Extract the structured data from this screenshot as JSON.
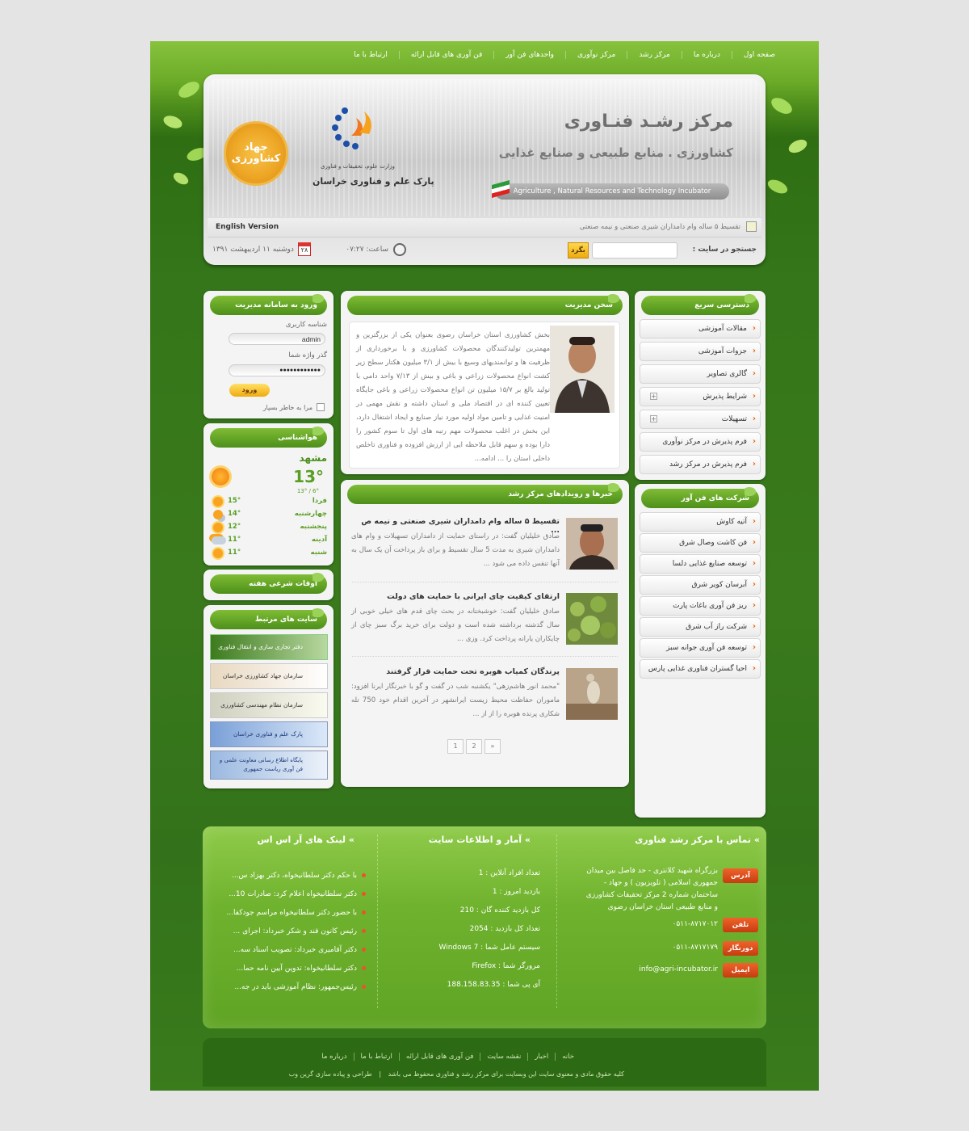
{
  "nav": {
    "items": [
      "صفحه اول",
      "درباره ما",
      "مرکز رشد",
      "مرکز نوآوری",
      "واحدهای فن آور",
      "فن آوری های قابل ارائه",
      "ارتباط با ما"
    ]
  },
  "header": {
    "title_line1": "مرکز رشـد فنـاوری",
    "title_line2": "کشاورزی . منابع طبیعی و صنایع غذایی",
    "english_banner": "Agriculture , Natural Resources and Technology Incubator",
    "park_name": "پارک علم و فناوری خراسان",
    "park_ministry": "وزارت علوم، تحقیقات و فناوری",
    "jahad_logo_text": "جهاد کشاورزی",
    "ticker": "تقسیط ۵ ساله وام دامداران شیری صنعتی و نیمه صنعتی",
    "english_version": "English Version",
    "search_label": "جستجو در سایت :",
    "search_button": "بگرد",
    "search_placeholder": "",
    "time_label": "ساعت: ۰۷:۲۷",
    "date_text": "دوشنبه ۱۱ اردیبهشت ۱۳۹۱",
    "calendar_day": "۲۸"
  },
  "quick_access": {
    "title": "دسترسی سریع",
    "items": [
      "مقالات آموزشی",
      "جزوات آموزشی",
      "گالری تصاویر",
      "شرایط پذیرش",
      "تسهیلات",
      "فرم پذیرش در مرکز نوآوری",
      "فرم پذیرش در مرکز رشد"
    ]
  },
  "companies": {
    "title": "شرکت های فن آور",
    "items": [
      "آتیه کاوش",
      "فن کاشت وصال شرق",
      "توسعه صنایع غذایی دلسا",
      "آبرسان کویر شرق",
      "ریز فن آوری باغات پارت",
      "شرکت راز آب شرق",
      "توسعه فن آوری جوانه سبز",
      "احیا گستران فناوری غذایی پارس"
    ]
  },
  "manager": {
    "title": "سخن مدیریت",
    "text": "بخش کشاورزی استان خراسان رضوی بعنوان یکی از بزرگترین و مهمترین تولیدکنندگان محصولات کشاورزی و با برخورداری از ظرفیت ها و توانمندیهای وسیع با بیش از ۳/۱ میلیون هکتار سطح زیر کشت انواع محصولات زراعی و باغی و بیش از ۷/۱۳ واحد دامی با تولید بالغ بر ۱۵/۷ میلیون تن انواع محصولات زراعی و باغی جایگاه تعیین کننده ای در اقتصاد ملی و استان داشته و نقش مهمی در امنیت غذایی و تامین مواد اولیه مورد نیاز صنایع و ایجاد اشتغال دارد، این بخش در اغلب محصولات مهم رتبه های اول تا سوم کشور را دارا بوده و سهم قابل ملاحظه ایی از ارزش افزوده و فناوری تاخلص داخلی استان را ... ادامه..."
  },
  "news": {
    "title": "خبرها و رویدادهای مرکز رشد",
    "items": [
      {
        "title": "تقسیط ۵ ساله وام دامداران شیری صنعتی و نیمه ص ...",
        "body": "صادق خلیلیان گفت: در راستای حمایت از دامداران تسهیلات و وام های دامداران شیری به مدت 5 سال تقسیط و برای باز پرداخت آن یک سال به آنها تنفس داده می شود ..."
      },
      {
        "title": "ارتقای کیفیت چای ایرانی با حمایت های دولت",
        "body": "صادق خلیلیان گفت: خوشبختانه در بحث چای قدم های خیلی خوبی از سال گذشته برداشته شده است و دولت برای خرید برگ سبز چای از چایکاران یارانه پرداخت کرد. وزی ..."
      },
      {
        "title": "پرندگان کمیاب هوبره تحت حمایت قرار گرفتند",
        "body": "\"محمد انور هاشم‌زهی\" یکشنبه شب در گفت و گو با خبرنگار ایرنا افزود: ماموران حفاظت محیط زیست ایرانشهر در آخرین اقدام خود 750 تله شکاری پرنده هوبره را از از ..."
      }
    ],
    "pages": [
      "1",
      "2",
      "»"
    ]
  },
  "login": {
    "title": "ورود به سامانه مدیریت",
    "user_label": "شناسه کاربری",
    "user_value": "admin",
    "pass_label": "گذر واژه شما",
    "pass_value": "●●●●●●●●●●●●",
    "submit": "ورود",
    "remember": "مرا به خاطر بسپار"
  },
  "weather": {
    "title": "هواشناسی",
    "city": "مشهد",
    "temp": "13°",
    "range": "13° / 6°",
    "days": [
      {
        "name": "فردا",
        "temp": "15°",
        "icon": "sun-icon"
      },
      {
        "name": "چهارشنبه",
        "temp": "14°",
        "icon": "partly-cloudy-icon"
      },
      {
        "name": "پنجشنبه",
        "temp": "12°",
        "icon": "sun-icon"
      },
      {
        "name": "آدینه",
        "temp": "11°",
        "icon": "cloud-icon"
      },
      {
        "name": "شنبه",
        "temp": "11°",
        "icon": "sun-icon"
      }
    ]
  },
  "prayer": {
    "title": "اوقات شرعی هفته"
  },
  "related": {
    "title": "سایت های مرتبط",
    "items": [
      "دفتر تجاری سازی و انتقال فناوری",
      "سازمان جهاد کشاورزی خراسان رضوی",
      "سازمان نظام مهندسی کشاورزی",
      "پارک علم و فناوری خراسان",
      "پایگاه اطلاع رسانی معاونت علمی و فن آوری ریاست جمهوری"
    ]
  },
  "contact": {
    "title": "» تماس با مرکز رشد فناوری",
    "address_tag": "آدرس",
    "address": [
      "بزرگراه شهید کلانتری - حد فاصل بین میدان",
      "جمهوری اسلامی ( تلویزیون ) و جهاد -",
      "ساختمان شماره 2 مرکز تحقیقات کشاورزی",
      "و منابع طبیعی استان خراسان رضوی"
    ],
    "phone_tag": "تلفن",
    "phone": "۰۵۱۱-۸۷۱۷۰۱۲",
    "fax_tag": "دورنگار",
    "fax": "۰۵۱۱-۸۷۱۷۱۷۹",
    "email_tag": "ایمیل",
    "email": "info@agri-incubator.ir"
  },
  "stats": {
    "title": "» آمار و اطلاعات سایت",
    "lines": [
      "تعداد افراد آنلاین : 1",
      "بازدید امروز : 1",
      "کل بازدید کننده گان : 210",
      "تعداد کل بازدید : 2054",
      "سیستم عامل شما : Windows 7",
      "مرورگر شما : Firefox",
      "آی پی شما : 188.158.83.35"
    ]
  },
  "rss": {
    "title": "» لینک های آر اس اس",
    "items": [
      "با حکم دکتر سلطانیخواه، دکتر بهزاد س...",
      "دکتر سلطانیخواه اعلام کرد: صادرات 10...",
      "با حضور دکتر سلطانیخواه مراسم جودکفا...",
      "رئیس کانون قند و شکر خبرداد: اجرای ...",
      "دکتر آقامیری خبرداد: تصویب اسناد سه...",
      "دکتر سلطانیخواه: تدوین آیین نامه حما...",
      "رئیس‌جمهور: نظام آموزشی باید در جه..."
    ]
  },
  "footer": {
    "links": [
      "خانه",
      "اخبار",
      "نقشه سایت",
      "فن آوری های قابل ارائه",
      "ارتباط با ما",
      "درباره ما"
    ],
    "copyright": "کلیه حقوق مادی و معنوی سایت این وبسایت برای مرکز رشد و فناوری محفوظ می باشد",
    "designer": "طراحی و پیاده سازی گرین وب"
  },
  "colors": {
    "accent_green": "#5fa424",
    "tag_orange": "#d8481a",
    "link_orange": "#e8650a"
  }
}
